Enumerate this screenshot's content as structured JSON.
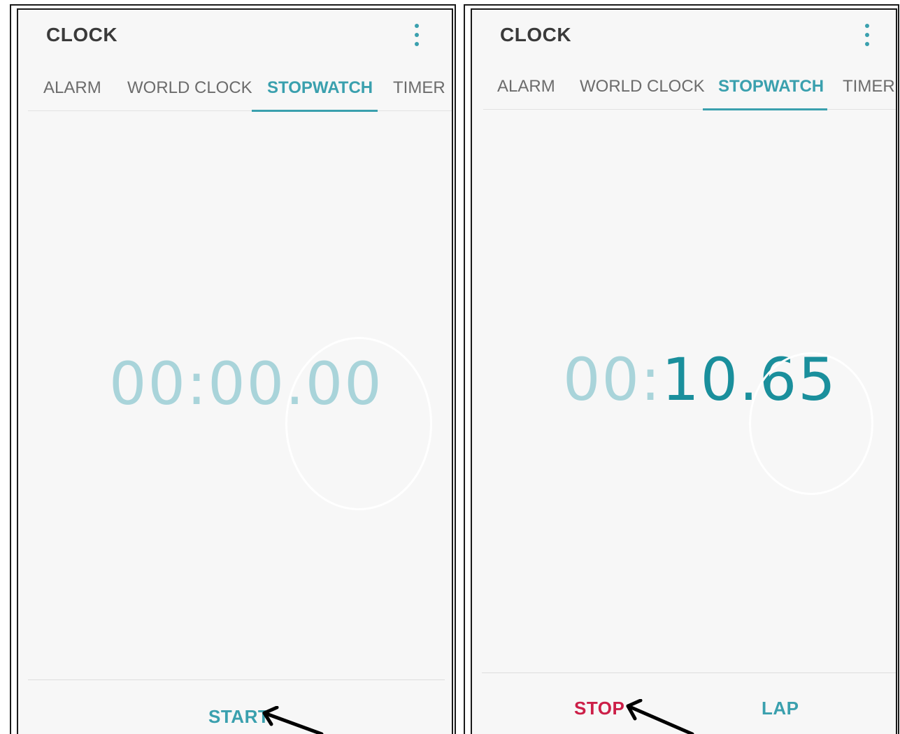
{
  "panels": [
    {
      "app_title": "CLOCK",
      "tabs": [
        "ALARM",
        "WORLD CLOCK",
        "STOPWATCH",
        "TIMER"
      ],
      "active_tab": "STOPWATCH",
      "display_dim": "00:00.00",
      "display_bright": "",
      "actions": [
        "START"
      ]
    },
    {
      "app_title": "CLOCK",
      "tabs": [
        "ALARM",
        "WORLD CLOCK",
        "STOPWATCH",
        "TIMER"
      ],
      "active_tab": "STOPWATCH",
      "display_dim": "00:",
      "display_bright": "10.65",
      "actions": [
        "STOP",
        "LAP"
      ]
    }
  ],
  "colors": {
    "accent": "#3aa0ae",
    "accent_dark": "#1a8f9c",
    "dim_digits": "#a9d4da",
    "stop_red": "#cc1f48",
    "background": "#f7f7f7"
  },
  "icons": [
    "more-vert-icon",
    "annotation-arrow-icon"
  ]
}
